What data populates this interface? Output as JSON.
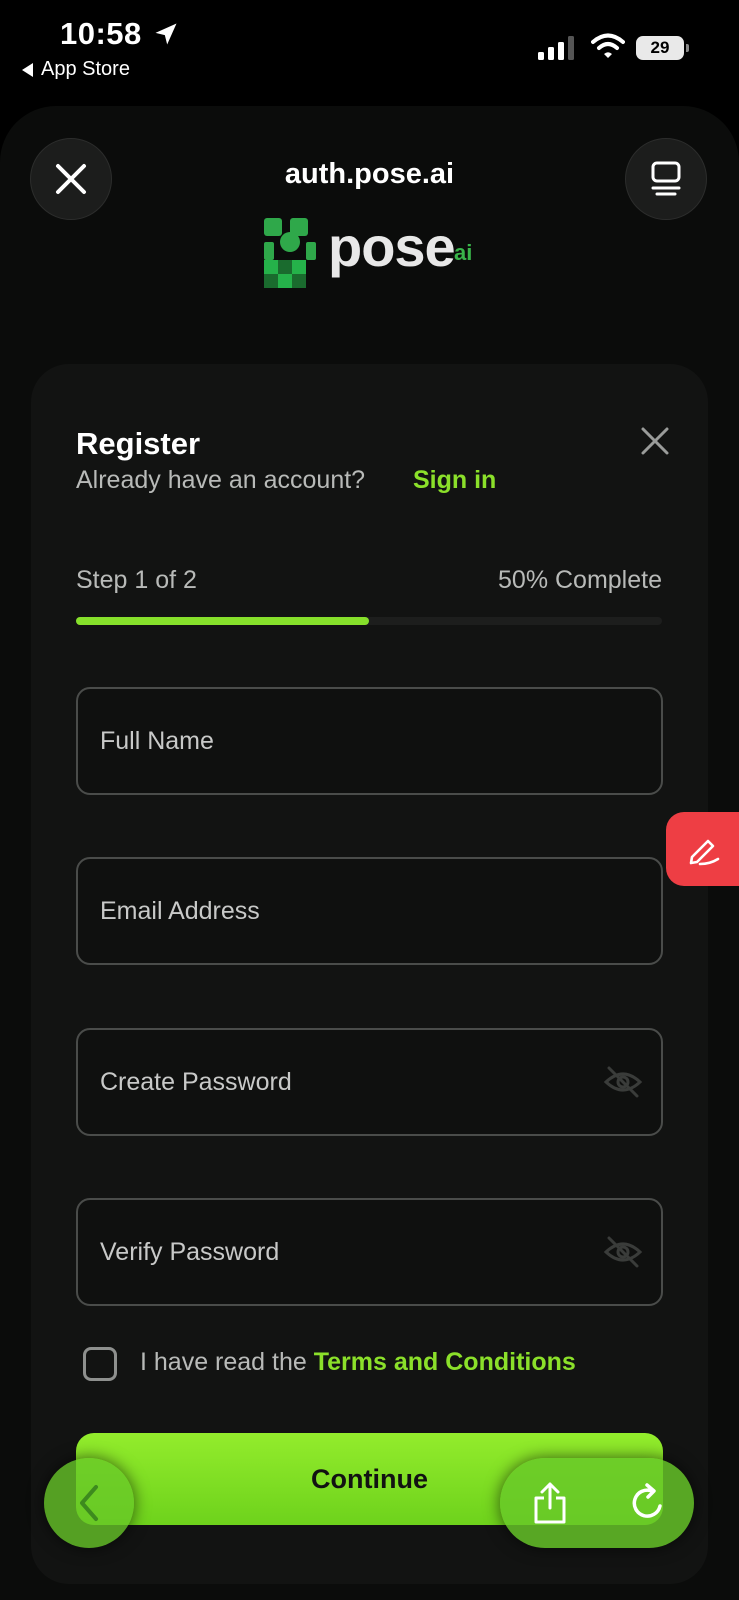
{
  "status_bar": {
    "time": "10:58",
    "back_app": "App Store",
    "battery": "29"
  },
  "browser": {
    "url": "auth.pose.ai",
    "close_icon": "close-icon",
    "tabs_icon": "tabs-icon"
  },
  "logo": {
    "word": "pose",
    "suffix": "ai"
  },
  "register": {
    "title": "Register",
    "subtitle": "Already have an account?",
    "sign_in": "Sign in",
    "step": "Step 1 of 2",
    "percent_label": "50% Complete",
    "progress": 0.5
  },
  "fields": {
    "full_name": "Full Name",
    "email": "Email Address",
    "create_password": "Create Password",
    "verify_password": "Verify Password"
  },
  "terms": {
    "prefix": "I have read the ",
    "link": "Terms and Conditions",
    "checked": false
  },
  "continue_label": "Continue",
  "colors": {
    "accent": "#86e02b",
    "edit_fab": "#ee3e44",
    "background": "#0b0c0b"
  }
}
